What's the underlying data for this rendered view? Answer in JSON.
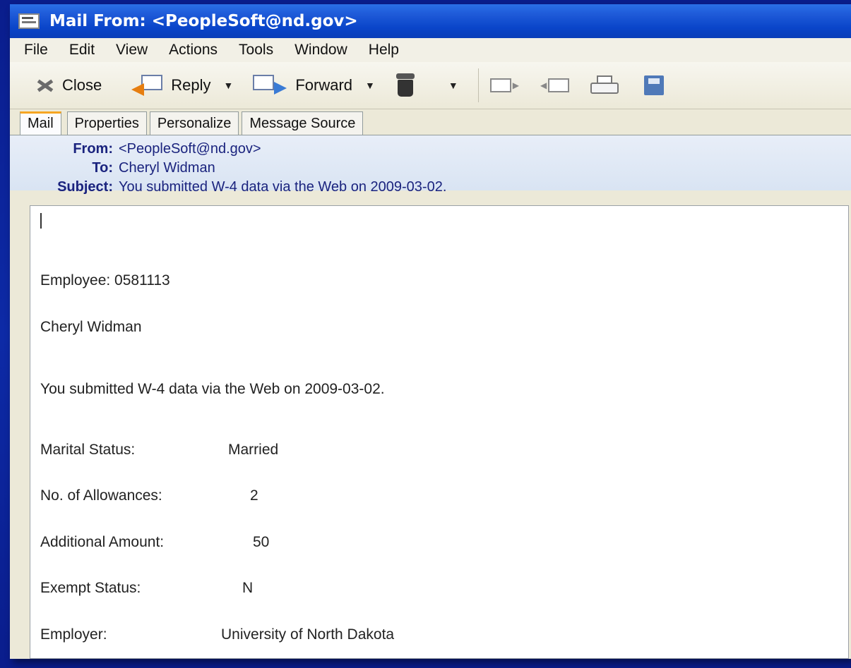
{
  "window": {
    "title": "Mail From: <PeopleSoft@nd.gov>"
  },
  "menubar": [
    "File",
    "Edit",
    "View",
    "Actions",
    "Tools",
    "Window",
    "Help"
  ],
  "toolbar": {
    "close_label": "Close",
    "reply_label": "Reply",
    "forward_label": "Forward"
  },
  "tabs": [
    "Mail",
    "Properties",
    "Personalize",
    "Message Source"
  ],
  "header": {
    "from_label": "From:",
    "from_value": "<PeopleSoft@nd.gov>",
    "to_label": "To:",
    "to_value": "Cheryl Widman",
    "subject_label": "Subject:",
    "subject_value": "You submitted W-4 data via the Web on 2009-03-02."
  },
  "body": {
    "employee": "Employee: 0581113",
    "name": "Cheryl Widman",
    "message": "You submitted W-4 data via the Web on 2009-03-02.",
    "fields": [
      {
        "label": "Marital Status:",
        "value": "Married"
      },
      {
        "label": "No. of Allowances:",
        "value": "2"
      },
      {
        "label": "Additional Amount:",
        "value": "50"
      },
      {
        "label": "Exempt Status:",
        "value": "N"
      },
      {
        "label": "Employer:",
        "value": "University of North Dakota"
      }
    ]
  }
}
